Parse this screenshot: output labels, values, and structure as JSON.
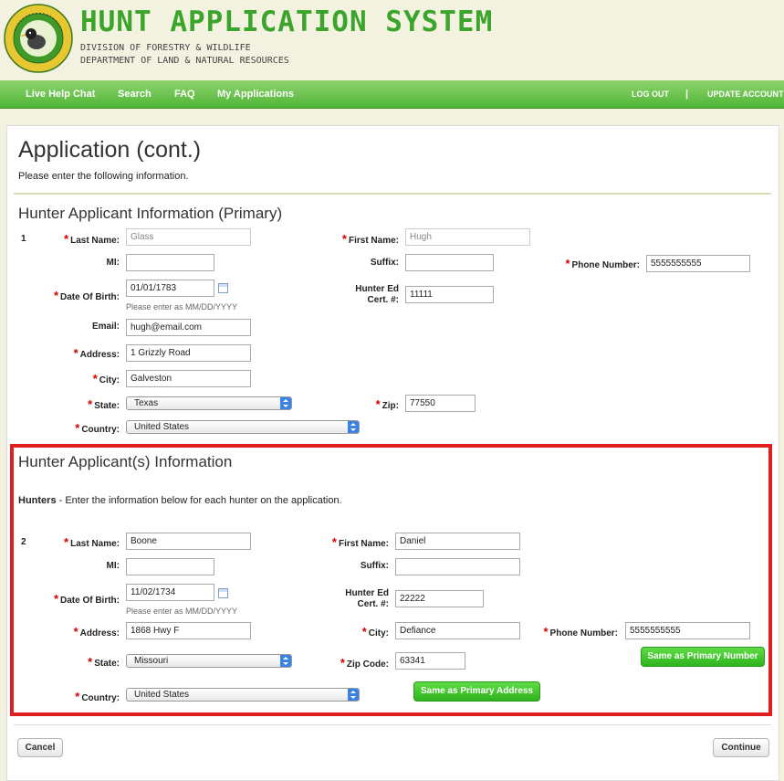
{
  "header": {
    "title": "HUNT APPLICATION SYSTEM",
    "subtitle_1": "DIVISION OF FORESTRY & WILDLIFE",
    "subtitle_2": "DEPARTMENT OF LAND & NATURAL RESOURCES",
    "logo_text_top": "FORESTRY AND WILDLIFE",
    "logo_text_bottom": "HAWAII"
  },
  "nav": {
    "live_help": "Live Help Chat",
    "search": "Search",
    "faq": "FAQ",
    "my_applications": "My Applications",
    "logout": "LOG OUT",
    "separator": "|",
    "update_account": "UPDATE ACCOUNT"
  },
  "page": {
    "title": "Application (cont.)",
    "intro": "Please enter the following information."
  },
  "labels": {
    "last_name": "Last Name:",
    "first_name": "First Name:",
    "mi": "MI:",
    "suffix": "Suffix:",
    "phone": "Phone Number:",
    "dob": "Date Of Birth:",
    "dob_hint": "Please enter as MM/DD/YYYY",
    "hunter_ed_1": "Hunter Ed",
    "hunter_ed_2": "Cert. #:",
    "email": "Email:",
    "address": "Address:",
    "city": "City:",
    "state": "State:",
    "zip": "Zip:",
    "zip_code": "Zip Code:",
    "country": "Country:"
  },
  "primary": {
    "section_title": "Hunter Applicant Information (Primary)",
    "row_number": "1",
    "last_name": "Glass",
    "first_name": "Hugh",
    "mi": "",
    "suffix": "",
    "phone": "5555555555",
    "dob": "01/01/1783",
    "hunter_ed": "11111",
    "email": "hugh@email.com",
    "address": "1 Grizzly Road",
    "city": "Galveston",
    "state": "Texas",
    "zip": "77550",
    "country": "United States"
  },
  "hunters": {
    "section_title": "Hunter Applicant(s) Information",
    "intro_bold": "Hunters",
    "intro_text": " - Enter the information below for each hunter on the application.",
    "row_number": "2",
    "last_name": "Boone",
    "first_name": "Daniel",
    "mi": "",
    "suffix": "",
    "dob": "11/02/1734",
    "hunter_ed": "22222",
    "address": "1868 Hwy F",
    "city": "Defiance",
    "phone": "5555555555",
    "state": "Missouri",
    "zip": "63341",
    "country": "United States",
    "same_number_button": "Same as Primary Number",
    "same_address_button": "Same as Primary Address"
  },
  "footer": {
    "cancel": "Cancel",
    "continue": "Continue"
  },
  "colors": {
    "brand_green": "#3aa52a",
    "nav_green": "#4fb536",
    "highlight_red": "#e02020"
  }
}
